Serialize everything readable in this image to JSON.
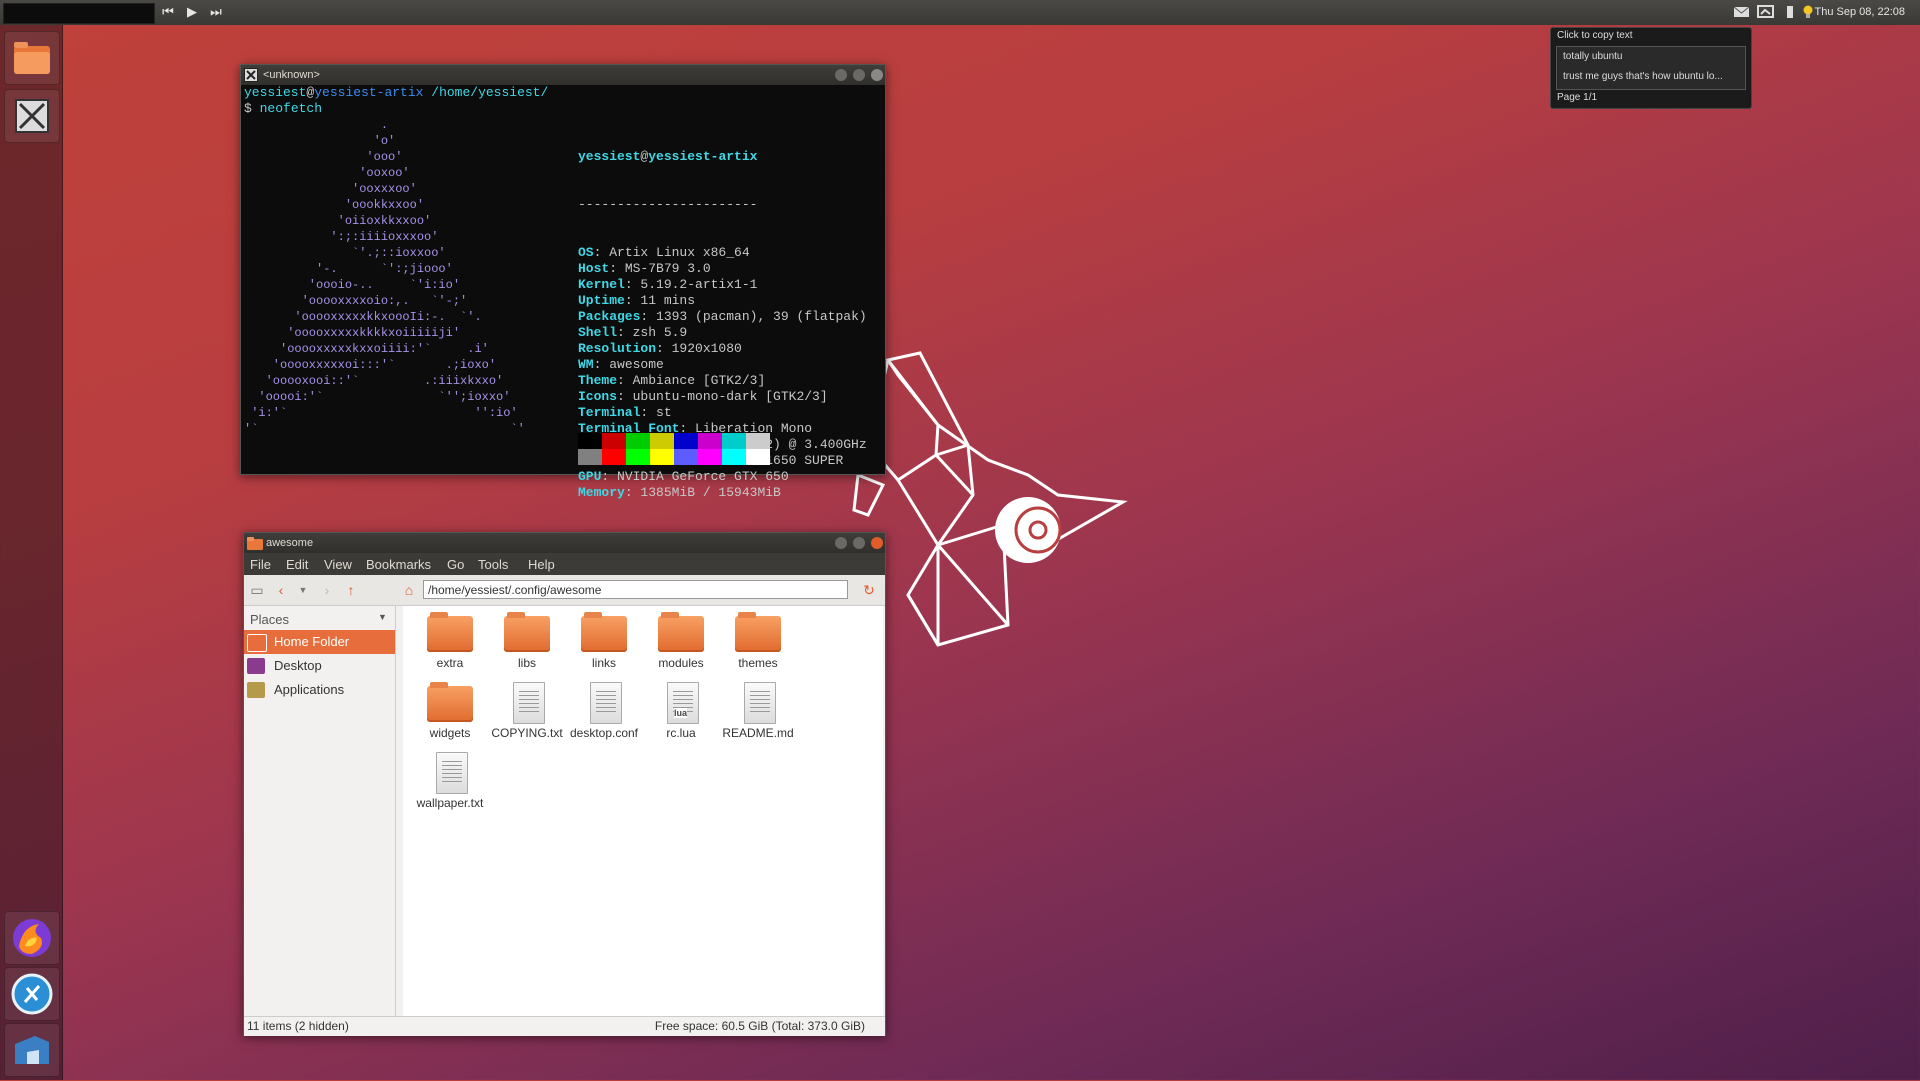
{
  "top_panel": {
    "clock": "Thu Sep 08, 22:08",
    "media": {
      "prev": "⏮",
      "play": "▶",
      "next": "⏭"
    }
  },
  "clipboard": {
    "header": "Click to copy text",
    "items": [
      "totally ubuntu",
      "trust me guys that's how ubuntu lo..."
    ],
    "page": "Page 1/1"
  },
  "terminal": {
    "title": "<unknown>",
    "prompt_user": "yessiest",
    "prompt_at": "@",
    "prompt_host": "yessiest-artix",
    "prompt_path": "/home/yessiest/",
    "prompt_symbol": "$",
    "command": "neofetch",
    "ascii_art": "                   .\n                  'o'\n                 'ooo'\n                'ooxoo'\n               'ooxxxoo'\n              'oookkxxoo'\n             'oiioxkkxxoo'\n            ':;:iiiioxxxoo'\n               `'.;::ioxxoo'\n          '-.      `':;jiooo'\n         'oooio-..     `'i:io'\n        'ooooxxxxoio:,.   `'-;'\n       'ooooxxxxxkkxoooIi:-.  `'.\n      'ooooxxxxxkkkkxoiiiiiji'\n     'ooooxxxxxkxxoiiii:'`     .i'\n    'ooooxxxxxoi:::'`       .;ioxo'\n   'ooooxooi::'`         .:iiixkxxo'\n  'ooooi:'`                `'';ioxxo'\n 'i:'`                          '':io'\n'`                                   `'",
    "neofetch": {
      "header_user": "yessiest",
      "header_host": "yessiest-artix",
      "separator": "-----------------------",
      "rows": [
        {
          "key": "OS",
          "value": "Artix Linux x86_64"
        },
        {
          "key": "Host",
          "value": "MS-7B79 3.0"
        },
        {
          "key": "Kernel",
          "value": "5.19.2-artix1-1"
        },
        {
          "key": "Uptime",
          "value": "11 mins"
        },
        {
          "key": "Packages",
          "value": "1393 (pacman), 39 (flatpak)"
        },
        {
          "key": "Shell",
          "value": "zsh 5.9"
        },
        {
          "key": "Resolution",
          "value": "1920x1080"
        },
        {
          "key": "WM",
          "value": "awesome"
        },
        {
          "key": "Theme",
          "value": "Ambiance [GTK2/3]"
        },
        {
          "key": "Icons",
          "value": "ubuntu-mono-dark [GTK2/3]"
        },
        {
          "key": "Terminal",
          "value": "st"
        },
        {
          "key": "Terminal Font",
          "value": "Liberation Mono"
        },
        {
          "key": "CPU",
          "value": "AMD Ryzen 5 2600 (12) @ 3.400GHz"
        },
        {
          "key": "GPU",
          "value": "NVIDIA GeForce GTX 1650 SUPER"
        },
        {
          "key": "GPU",
          "value": "NVIDIA GeForce GTX 650"
        },
        {
          "key": "Memory",
          "value": "1385MiB / 15943MiB"
        }
      ],
      "palette": [
        "#000000",
        "#cc0000",
        "#00cc00",
        "#cccc00",
        "#0000cc",
        "#cc00cc",
        "#00cccc",
        "#cccccc",
        "#808080",
        "#ff0000",
        "#00ff00",
        "#ffff00",
        "#5c5cff",
        "#ff00ff",
        "#00ffff",
        "#ffffff"
      ]
    }
  },
  "file_manager": {
    "title": "awesome",
    "menu": [
      "File",
      "Edit",
      "View",
      "Bookmarks",
      "Go",
      "Tools",
      "Help"
    ],
    "path": "/home/yessiest/.config/awesome",
    "places_header": "Places",
    "places": [
      {
        "label": "Home Folder",
        "icon": "home-folder-icon",
        "selected": true
      },
      {
        "label": "Desktop",
        "icon": "desktop-icon",
        "selected": false
      },
      {
        "label": "Applications",
        "icon": "applications-icon",
        "selected": false
      }
    ],
    "files": [
      {
        "name": "extra",
        "type": "folder"
      },
      {
        "name": "libs",
        "type": "folder"
      },
      {
        "name": "links",
        "type": "folder"
      },
      {
        "name": "modules",
        "type": "folder"
      },
      {
        "name": "themes",
        "type": "folder"
      },
      {
        "name": "widgets",
        "type": "folder"
      },
      {
        "name": "COPYING.txt",
        "type": "text"
      },
      {
        "name": "desktop.conf",
        "type": "text"
      },
      {
        "name": "rc.lua",
        "type": "lua",
        "badge": "lua"
      },
      {
        "name": "README.md",
        "type": "text"
      },
      {
        "name": "wallpaper.txt",
        "type": "text"
      }
    ],
    "status_left": "11 items (2 hidden)",
    "status_right": "Free space: 60.5 GiB (Total: 373.0 GiB)"
  }
}
